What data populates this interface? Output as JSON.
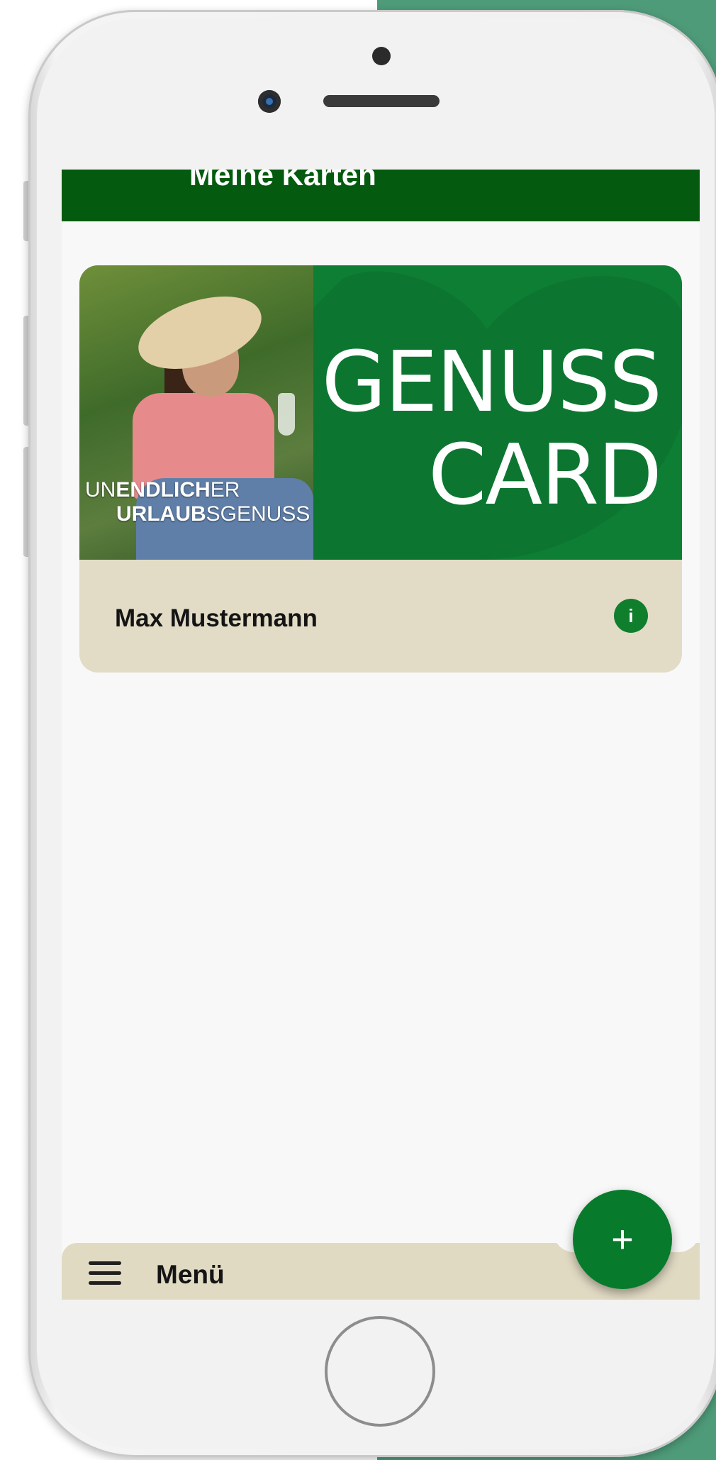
{
  "app": {
    "title": "Meine Karten"
  },
  "card": {
    "tagline_un": "UN",
    "tagline_endlich": "ENDLICH",
    "tagline_er": "ER",
    "tagline_urlaub": "URLAUB",
    "tagline_sgenuss": "SGENUSS",
    "brand_line1": "GENUSS",
    "brand_line2": "CARD",
    "holder_name": "Max Mustermann",
    "info_icon": "i"
  },
  "bottom_nav": {
    "menu_label": "Menü",
    "fab_icon": "+"
  },
  "colors": {
    "header_bg": "#045a0e",
    "brand_green": "#0f7e35",
    "card_footer_bg": "#e2dcc6",
    "fab_bg": "#087a2b"
  },
  "icons": {
    "menu": "hamburger-menu-icon",
    "add": "plus-icon",
    "info": "info-icon"
  }
}
